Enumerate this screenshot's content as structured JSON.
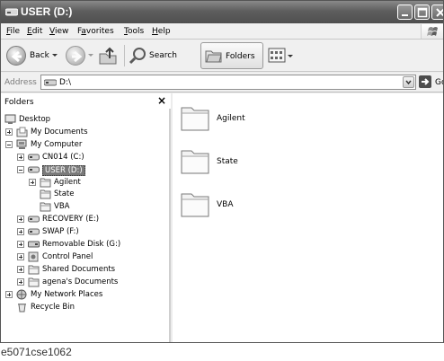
{
  "window": {
    "title": "USER (D:)"
  },
  "menu": {
    "items": [
      {
        "label": "File",
        "ul": "F",
        "rest": "ile"
      },
      {
        "label": "Edit",
        "ul": "E",
        "rest": "dit"
      },
      {
        "label": "View",
        "ul": "V",
        "rest": "iew"
      },
      {
        "label": "Favorites",
        "ul": "a",
        "pre": "F",
        "rest": "vorites"
      },
      {
        "label": "Tools",
        "ul": "T",
        "rest": "ools"
      },
      {
        "label": "Help",
        "ul": "H",
        "rest": "elp"
      }
    ]
  },
  "toolbar": {
    "back_label": "Back",
    "search_label": "Search",
    "folders_label": "Folders"
  },
  "address": {
    "label": "Address",
    "value": "D:\\",
    "go_label": "Go"
  },
  "folders_pane": {
    "title": "Folders",
    "close_label": "×",
    "tree": [
      {
        "label": "Desktop",
        "icon": "desktop-icon",
        "expander": "none"
      },
      {
        "label": "My Documents",
        "icon": "documents-icon",
        "expander": "plus"
      },
      {
        "label": "My Computer",
        "icon": "computer-icon",
        "expander": "minus"
      },
      {
        "label": "CN014 (C:)",
        "icon": "drive-icon",
        "expander": "plus"
      },
      {
        "label": "USER (D:)",
        "icon": "drive-icon",
        "expander": "minus",
        "selected": true
      },
      {
        "label": "Agilent",
        "icon": "folder-icon",
        "expander": "plus"
      },
      {
        "label": "State",
        "icon": "folder-icon",
        "expander": "none"
      },
      {
        "label": "VBA",
        "icon": "folder-icon",
        "expander": "none"
      },
      {
        "label": "RECOVERY (E:)",
        "icon": "drive-icon",
        "expander": "plus"
      },
      {
        "label": "SWAP (F:)",
        "icon": "drive-icon",
        "expander": "plus"
      },
      {
        "label": "Removable Disk (G:)",
        "icon": "removable-drive-icon",
        "expander": "plus"
      },
      {
        "label": "Control Panel",
        "icon": "control-panel-icon",
        "expander": "plus"
      },
      {
        "label": "Shared Documents",
        "icon": "folder-icon",
        "expander": "plus"
      },
      {
        "label": "agena's Documents",
        "icon": "folder-icon",
        "expander": "plus"
      },
      {
        "label": "My Network Places",
        "icon": "network-icon",
        "expander": "plus"
      },
      {
        "label": "Recycle Bin",
        "icon": "recycle-bin-icon",
        "expander": "none"
      }
    ]
  },
  "content": {
    "items": [
      {
        "name": "Agilent"
      },
      {
        "name": "State"
      },
      {
        "name": "VBA"
      }
    ]
  },
  "caption": "e5071cse1062"
}
